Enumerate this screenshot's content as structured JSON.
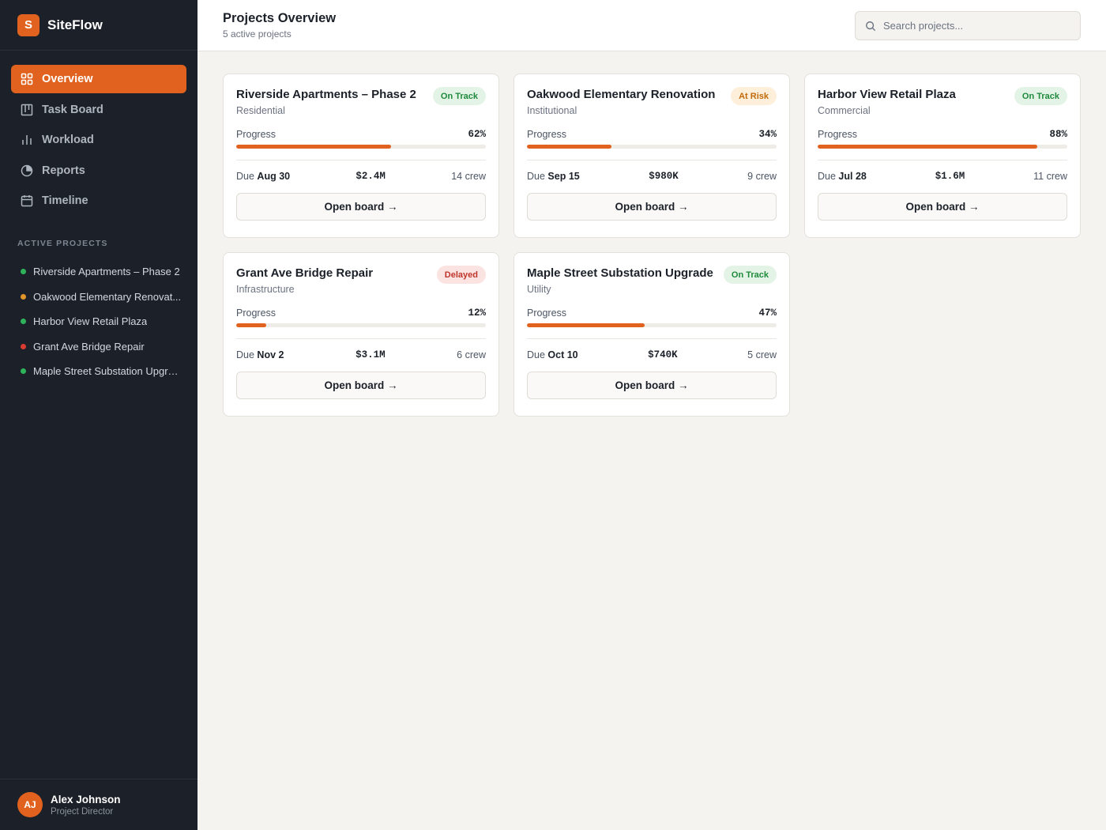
{
  "brand": {
    "logo_letter": "S",
    "name": "SiteFlow"
  },
  "nav": [
    {
      "label": "Overview",
      "icon": "grid-icon",
      "active": true
    },
    {
      "label": "Task Board",
      "icon": "kanban-icon",
      "active": false
    },
    {
      "label": "Workload",
      "icon": "bar-chart-icon",
      "active": false
    },
    {
      "label": "Reports",
      "icon": "pie-chart-icon",
      "active": false
    },
    {
      "label": "Timeline",
      "icon": "calendar-icon",
      "active": false
    }
  ],
  "active_projects_label": "ACTIVE PROJECTS",
  "active_projects": [
    {
      "name": "Riverside Apartments – Phase 2",
      "color": "#2fb35a"
    },
    {
      "name": "Oakwood Elementary Renovat...",
      "color": "#e0952a"
    },
    {
      "name": "Harbor View Retail Plaza",
      "color": "#2fb35a"
    },
    {
      "name": "Grant Ave Bridge Repair",
      "color": "#d83b30"
    },
    {
      "name": "Maple Street Substation Upgra...",
      "color": "#2fb35a"
    }
  ],
  "user": {
    "initials": "AJ",
    "name": "Alex Johnson",
    "role": "Project Director"
  },
  "header": {
    "title": "Projects Overview",
    "subtitle": "5 active projects",
    "search_placeholder": "Search projects..."
  },
  "labels": {
    "progress": "Progress",
    "due": "Due",
    "open_board": "Open board →"
  },
  "projects": [
    {
      "title": "Riverside Apartments – Phase 2",
      "type": "Residential",
      "status": "On Track",
      "status_class": "on-track",
      "progress": 62,
      "progress_label": "62%",
      "due": "Aug 30",
      "budget": "$2.4M",
      "crew": "14 crew"
    },
    {
      "title": "Oakwood Elementary Renovation",
      "type": "Institutional",
      "status": "At Risk",
      "status_class": "at-risk",
      "progress": 34,
      "progress_label": "34%",
      "due": "Sep 15",
      "budget": "$980K",
      "crew": "9 crew"
    },
    {
      "title": "Harbor View Retail Plaza",
      "type": "Commercial",
      "status": "On Track",
      "status_class": "on-track",
      "progress": 88,
      "progress_label": "88%",
      "due": "Jul 28",
      "budget": "$1.6M",
      "crew": "11 crew"
    },
    {
      "title": "Grant Ave Bridge Repair",
      "type": "Infrastructure",
      "status": "Delayed",
      "status_class": "delayed",
      "progress": 12,
      "progress_label": "12%",
      "due": "Nov 2",
      "budget": "$3.1M",
      "crew": "6 crew"
    },
    {
      "title": "Maple Street Substation Upgrade",
      "type": "Utility",
      "status": "On Track",
      "status_class": "on-track",
      "progress": 47,
      "progress_label": "47%",
      "due": "Oct 10",
      "budget": "$740K",
      "crew": "5 crew"
    }
  ],
  "colors": {
    "accent": "#e0621e",
    "sidebar_bg": "#1c2129",
    "page_bg": "#f4f3ef"
  }
}
